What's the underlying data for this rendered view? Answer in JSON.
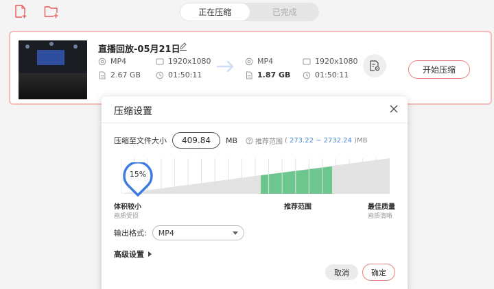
{
  "toolbar": {
    "add_file_icon": "add-file-icon",
    "add_folder_icon": "add-folder-icon"
  },
  "tabs": [
    {
      "label": "正在压缩",
      "active": true
    },
    {
      "label": "已完成",
      "active": false
    }
  ],
  "file": {
    "title": "直播回放-05月21日",
    "source": {
      "format": "MP4",
      "resolution": "1920x1080",
      "size": "2.67 GB",
      "duration": "01:50:11"
    },
    "target": {
      "format": "MP4",
      "resolution": "1920x1080",
      "size": "1.87 GB",
      "duration": "01:50:11"
    },
    "start_label": "开始压缩"
  },
  "dialog": {
    "title": "压缩设置",
    "size_label": "压缩至文件大小",
    "size_value": "409.84",
    "size_unit": "MB",
    "hint_prefix": "推荐范围",
    "hint_range_open": "(",
    "hint_range": "273.22 ~ 2732.24",
    "hint_range_close": ")MB",
    "marker_percent": "15%",
    "marker_fraction": 0.15,
    "scale_left_main": "体积较小",
    "scale_left_sub": "画质受损",
    "scale_mid_main": "推荐范围",
    "scale_right_main": "最佳质量",
    "scale_right_sub": "画质清晰",
    "format_label": "输出格式:",
    "format_value": "MP4",
    "advanced_label": "高级设置",
    "cancel_label": "取消",
    "ok_label": "确定"
  },
  "colors": {
    "accent_border": "#e87e7e",
    "recommend_green": "#6cc68d",
    "marker_blue": "#3d7be0",
    "hint_blue": "#4a86d8"
  }
}
